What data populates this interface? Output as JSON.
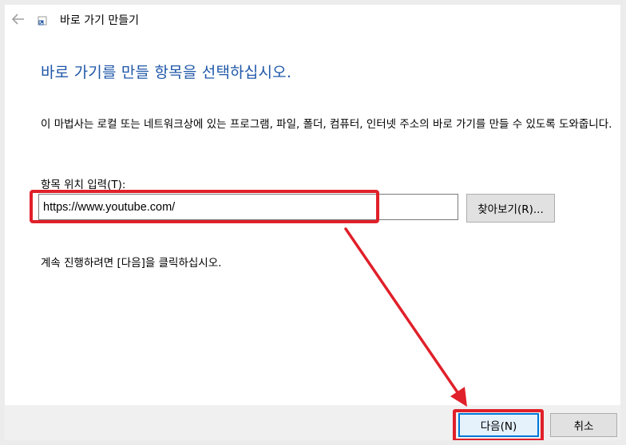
{
  "window": {
    "title": "바로 가기 만들기",
    "back_icon": "back-arrow-icon",
    "app_icon": "shortcut-icon"
  },
  "main": {
    "heading": "바로 가기를 만들 항목을 선택하십시오.",
    "description": "이 마법사는 로컬 또는 네트워크상에 있는 프로그램, 파일, 폴더, 컴퓨터, 인터넷 주소의 바로 가기를 만들 수 있도록 도와줍니다.",
    "location_label": "항목 위치 입력(T):",
    "location_value": "https://www.youtube.com/",
    "browse_label": "찾아보기(R)...",
    "continue_text": "계속 진행하려면 [다음]을 클릭하십시오."
  },
  "footer": {
    "next_label": "다음(N)",
    "cancel_label": "취소"
  },
  "annotation": {
    "highlight_color": "#e0202a",
    "accent_color": "#1f57a8"
  }
}
